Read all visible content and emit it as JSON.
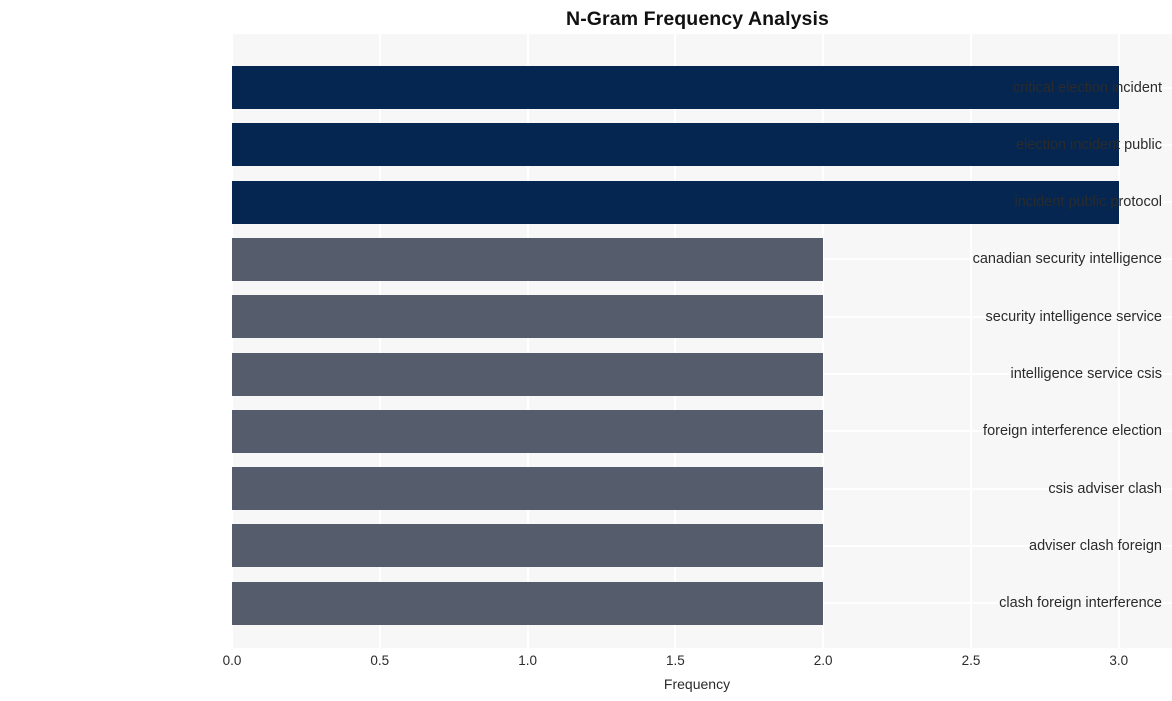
{
  "chart_data": {
    "type": "bar",
    "orientation": "horizontal",
    "title": "N-Gram Frequency Analysis",
    "xlabel": "Frequency",
    "ylabel": "",
    "xlim": [
      0.0,
      3.18
    ],
    "xticks": [
      "0.0",
      "0.5",
      "1.0",
      "1.5",
      "2.0",
      "2.5",
      "3.0"
    ],
    "xtick_values": [
      0.0,
      0.5,
      1.0,
      1.5,
      2.0,
      2.5,
      3.0
    ],
    "grid": true,
    "legend": "none",
    "categories": [
      "critical election incident",
      "election incident public",
      "incident public protocol",
      "canadian security intelligence",
      "security intelligence service",
      "intelligence service csis",
      "foreign interference election",
      "csis adviser clash",
      "adviser clash foreign",
      "clash foreign interference"
    ],
    "values": [
      3,
      3,
      3,
      2,
      2,
      2,
      2,
      2,
      2,
      2
    ],
    "bar_colors": [
      "#042650",
      "#042650",
      "#042650",
      "#555c6b",
      "#555c6b",
      "#555c6b",
      "#555c6b",
      "#555c6b",
      "#555c6b",
      "#555c6b"
    ],
    "colors": {
      "high": "#042650",
      "low": "#555c6b",
      "plot_background": "#f7f7f8",
      "figure_background": "#ffffff",
      "grid": "#ffffff",
      "text": "#2b2b2b",
      "title_text": "#111111"
    }
  }
}
